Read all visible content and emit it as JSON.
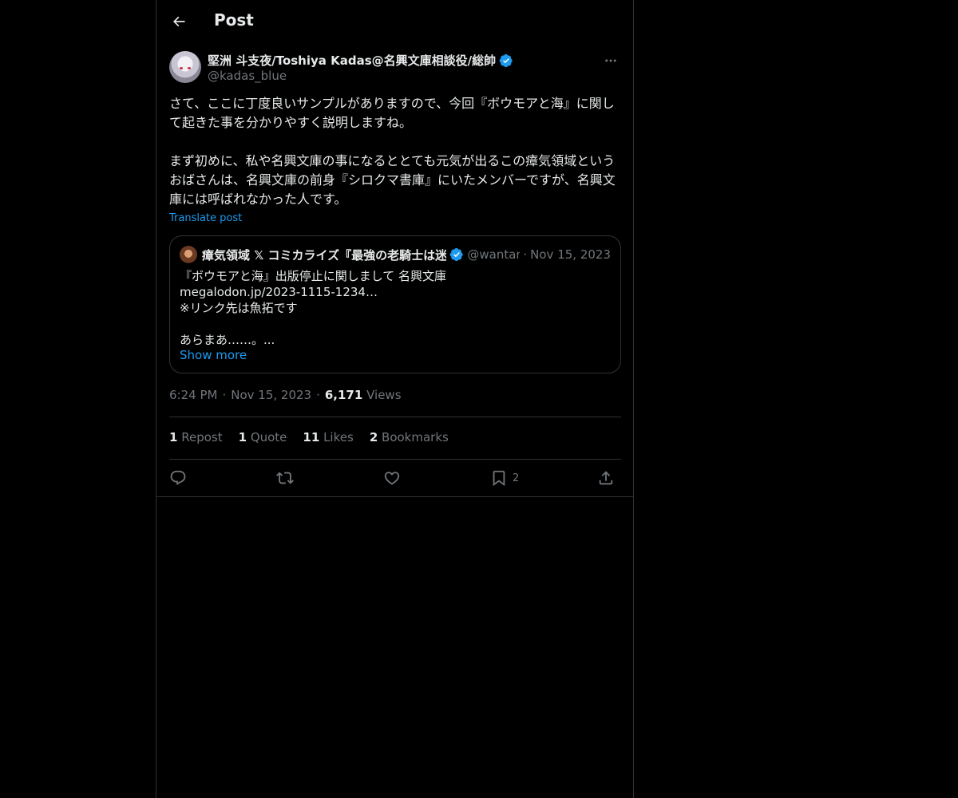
{
  "header": {
    "title": "Post"
  },
  "author": {
    "display_name": "堅洲 斗支夜/Toshiya Kadas@名興文庫相談役/総帥",
    "handle": "@kadas_blue"
  },
  "post": {
    "text": "さて、ここに丁度良いサンプルがありますので、今回『ボウモアと海』に関して起きた事を分かりやすく説明しますね。\n\nまず初めに、私や名興文庫の事になるととても元気が出るこの瘴気領域というおばさんは、名興文庫の前身『シロクマ書庫』にいたメンバーですが、名興文庫には呼ばれなかった人です。",
    "translate_label": "Translate post"
  },
  "quote": {
    "name": "瘴気領域 𝕏 コミカライズ『最強の老騎士は迷宮",
    "handle": "@wantan_",
    "separator": "·",
    "date": "Nov 15, 2023",
    "body": "『ボウモアと海』出版停止に関しまして 名興文庫\nmegalodon.jp/2023-1115-1234…\n※リンク先は魚拓です\n\nあらまあ……。...",
    "show_more": "Show more"
  },
  "meta": {
    "time": "6:24 PM",
    "dot": "·",
    "date": "Nov 15, 2023",
    "views_count": "6,171",
    "views_label": "Views"
  },
  "stats": {
    "reposts_count": "1",
    "reposts_label": "Repost",
    "quotes_count": "1",
    "quotes_label": "Quote",
    "likes_count": "11",
    "likes_label": "Likes",
    "bookmarks_count": "2",
    "bookmarks_label": "Bookmarks"
  },
  "actions": {
    "reply_icon": "reply-icon",
    "repost_icon": "repost-icon",
    "like_icon": "heart-icon",
    "bookmark_icon": "bookmark-icon",
    "bookmark_count": "2",
    "share_icon": "share-icon"
  },
  "colors": {
    "background": "#000000",
    "text": "#e7e9ea",
    "muted": "#71767b",
    "accent": "#1d9bf0",
    "border": "#2f3336"
  }
}
